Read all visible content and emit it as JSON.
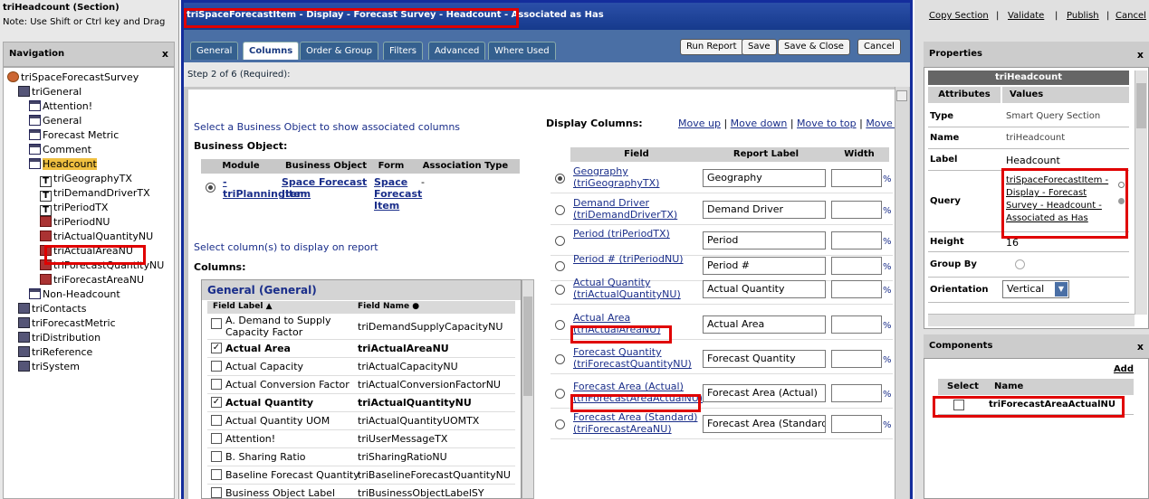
{
  "left": {
    "title": "triHeadcount (Section)",
    "note": "Note: Use Shift or Ctrl key and Drag",
    "nav_title": "Navigation",
    "close": "x",
    "tree": [
      {
        "label": "triSpaceForecastSurvey",
        "icon": "root-icon"
      },
      {
        "label": "triGeneral",
        "icon": "folder-icon"
      },
      {
        "label": "Attention!",
        "icon": "form-icon"
      },
      {
        "label": "General",
        "icon": "form-icon"
      },
      {
        "label": "Forecast Metric",
        "icon": "form-icon"
      },
      {
        "label": "Comment",
        "icon": "form-icon"
      },
      {
        "label": "Headcount",
        "icon": "form-icon"
      },
      {
        "label": "triGeographyTX",
        "icon": "text-field-icon"
      },
      {
        "label": "triDemandDriverTX",
        "icon": "text-field-icon"
      },
      {
        "label": "triPeriodTX",
        "icon": "text-field-icon"
      },
      {
        "label": "triPeriodNU",
        "icon": "number-field-icon"
      },
      {
        "label": "triActualQuantityNU",
        "icon": "number-field-icon"
      },
      {
        "label": "triActualAreaNU",
        "icon": "number-field-icon"
      },
      {
        "label": "triForecastQuantityNU",
        "icon": "number-field-icon"
      },
      {
        "label": "triForecastAreaNU",
        "icon": "number-field-icon"
      },
      {
        "label": "Non-Headcount",
        "icon": "form-icon"
      },
      {
        "label": "triContacts",
        "icon": "folder-icon"
      },
      {
        "label": "triForecastMetric",
        "icon": "folder-icon"
      },
      {
        "label": "triDistribution",
        "icon": "folder-icon"
      },
      {
        "label": "triReference",
        "icon": "folder-icon"
      },
      {
        "label": "triSystem",
        "icon": "folder-icon"
      }
    ]
  },
  "center": {
    "title": "triSpaceForecastItem - Display - Forecast Survey - Headcount - Associated as Has",
    "tabs": [
      "General",
      "Columns",
      "Order & Group",
      "Filters",
      "Advanced",
      "Where Used"
    ],
    "buttons": [
      "Run Report",
      "Save",
      "Save & Close",
      "Cancel"
    ],
    "step": "Step 2 of 6 (Required):",
    "select_bo_text": "Select a Business Object to show associated columns",
    "bo_label": "Business Object:",
    "bo_headers": [
      "Module",
      "Business Object",
      "Form",
      "Association Type"
    ],
    "bo_row": {
      "module": "triPlanningItem",
      "bo": "Space Forecast Item",
      "form": "Space Forecast Item",
      "assoc": "-",
      "dash": "-"
    },
    "select_cols_text": "Select column(s) to display on report",
    "columns_label": "Columns:",
    "general_hdr": "General (General)",
    "col_headers": [
      "Field Label ▲",
      "Field Name ●"
    ],
    "columns": [
      {
        "label": "A. Demand to Supply Capacity Factor",
        "name": "triDemandSupplyCapacityNU",
        "checked": false,
        "bold": false
      },
      {
        "label": "Actual Area",
        "name": "triActualAreaNU",
        "checked": true,
        "bold": true
      },
      {
        "label": "Actual Capacity",
        "name": "triActualCapacityNU",
        "checked": false,
        "bold": false
      },
      {
        "label": "Actual Conversion Factor",
        "name": "triActualConversionFactorNU",
        "checked": false,
        "bold": false
      },
      {
        "label": "Actual Quantity",
        "name": "triActualQuantityNU",
        "checked": true,
        "bold": true
      },
      {
        "label": "Actual Quantity UOM",
        "name": "triActualQuantityUOMTX",
        "checked": false,
        "bold": false
      },
      {
        "label": "Attention!",
        "name": "triUserMessageTX",
        "checked": false,
        "bold": false
      },
      {
        "label": "B. Sharing Ratio",
        "name": "triSharingRatioNU",
        "checked": false,
        "bold": false
      },
      {
        "label": "Baseline Forecast Quantity",
        "name": "triBaselineForecastQuantityNU",
        "checked": false,
        "bold": false
      },
      {
        "label": "Business Object Label",
        "name": "triBusinessObjectLabelSY",
        "checked": false,
        "bold": false
      }
    ],
    "display_label": "Display Columns:",
    "move_links": [
      "Move up",
      "Move down",
      "Move to top",
      "Move t"
    ],
    "display_headers": [
      "Field",
      "Report Label",
      "Width"
    ],
    "display_rows": [
      {
        "field": "Geography (triGeographyTX)",
        "report": "Geography",
        "selected": true
      },
      {
        "field": "Demand Driver (triDemandDriverTX)",
        "report": "Demand Driver",
        "selected": false
      },
      {
        "field": "Period (triPeriodTX)",
        "report": "Period",
        "selected": false
      },
      {
        "field": "Period # (triPeriodNU)",
        "report": "Period #",
        "selected": false
      },
      {
        "field": "Actual Quantity (triActualQuantityNU)",
        "report": "Actual Quantity",
        "selected": false
      },
      {
        "field": "Actual Area (triActualAreaNU)",
        "report": "Actual Area",
        "selected": false
      },
      {
        "field": "Forecast Quantity (triForecastQuantityNU)",
        "report": "Forecast Quantity",
        "selected": false
      },
      {
        "field": "Forecast Area (Actual) (triForecastAreaActualNU)",
        "report": "Forecast Area (Actual)",
        "selected": false
      },
      {
        "field": "Forecast Area (Standard) (triForecastAreaNU)",
        "report": "Forecast Area (Standard)",
        "selected": false
      }
    ],
    "pct": "%"
  },
  "right": {
    "top_links": [
      "Copy Section",
      "Validate",
      "Publish",
      "Cancel"
    ],
    "props_title": "Properties",
    "close": "x",
    "props_name_hdr": "triHeadcount",
    "attr_hdr": "Attributes",
    "val_hdr": "Values",
    "props": [
      {
        "k": "Type",
        "v": "Smart Query Section"
      },
      {
        "k": "Name",
        "v": "triHeadcount"
      },
      {
        "k": "Label",
        "v": "Headcount"
      },
      {
        "k": "Query",
        "v": "triSpaceForecastItem - Display - Forecast Survey - Headcount - Associated as Has"
      },
      {
        "k": "Height",
        "v": "16"
      },
      {
        "k": "Group By",
        "v": ""
      },
      {
        "k": "Orientation",
        "v": "Vertical"
      }
    ],
    "comp_title": "Components",
    "add": "Add",
    "comp_headers": [
      "Select",
      "Name"
    ],
    "comp_row": "triForecastAreaActualNU"
  }
}
